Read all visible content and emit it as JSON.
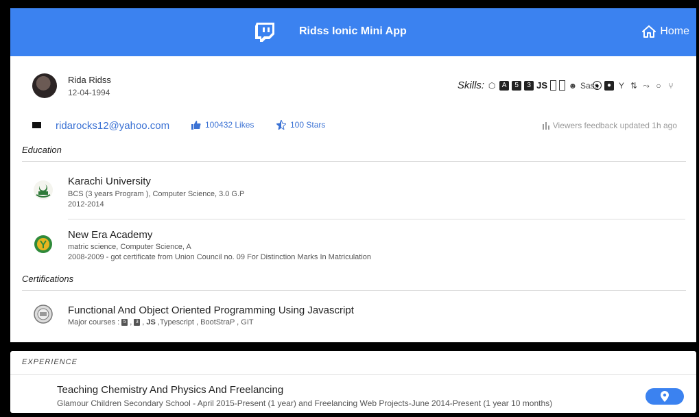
{
  "header": {
    "title": "Ridss Ionic Mini App",
    "home_label": "Home"
  },
  "profile": {
    "name": "Rida Ridss",
    "dob": "12-04-1994",
    "skills_label": "Skills:"
  },
  "skills_icons": [
    {
      "name": "nodejs-icon",
      "glyph": "⬡",
      "style": "thin"
    },
    {
      "name": "angular-icon",
      "glyph": "A",
      "style": "fill"
    },
    {
      "name": "html5-icon",
      "glyph": "5",
      "style": "fill"
    },
    {
      "name": "css3-icon",
      "glyph": "3",
      "style": "fill"
    },
    {
      "name": "javascript-icon",
      "glyph": "JS",
      "style": "js"
    },
    {
      "name": "mobile-icon",
      "glyph": "",
      "style": "rect"
    },
    {
      "name": "tablet-icon",
      "glyph": "",
      "style": "rect"
    },
    {
      "name": "reddit-icon",
      "glyph": "☻",
      "style": "thin"
    },
    {
      "name": "sass-icon",
      "glyph": "Sass",
      "style": "thin"
    },
    {
      "name": "ionic-icon",
      "glyph": "●",
      "style": "round"
    },
    {
      "name": "github-icon",
      "glyph": "●",
      "style": "fill"
    },
    {
      "name": "git-branch-icon",
      "glyph": "Y",
      "style": "thin"
    },
    {
      "name": "git-compare-icon",
      "glyph": "⇅",
      "style": "thin"
    },
    {
      "name": "git-merge-icon",
      "glyph": "⤳",
      "style": "thin"
    },
    {
      "name": "git-commit-icon",
      "glyph": "○",
      "style": "thin"
    },
    {
      "name": "git-network-icon",
      "glyph": "⑂",
      "style": "thin"
    }
  ],
  "contact": {
    "email": "ridarocks12@yahoo.com",
    "likes": "100432 Likes",
    "stars": "100 Stars",
    "feedback": "Viewers feedback updated 1h ago"
  },
  "education": {
    "title": "Education",
    "items": [
      {
        "name": "Karachi University",
        "detail": "BCS (3 years Program ), Computer Science, 3.0 G.P",
        "years": "2012-2014"
      },
      {
        "name": "New Era Academy",
        "detail": "matric science, Computer Science, A",
        "years": "2008-2009 - got certificate from Union Council no. 09 For Distinction Marks In Matriculation"
      }
    ]
  },
  "certifications": {
    "title": "Certifications",
    "items": [
      {
        "name": "Functional And Object Oriented Programming Using Javascript",
        "courses_label": "Major courses :",
        "courses_tail": ",Typescript , BootStraP , GIT"
      }
    ]
  },
  "experience": {
    "title": "EXPERIENCE",
    "items": [
      {
        "name": "Teaching Chemistry And Physics And Freelancing",
        "detail": "Glamour Children Secondary School - April 2015-Present (1 year) and Freelancing Web Projects-June 2014-Present (1 year 10 months)"
      }
    ]
  },
  "colors": {
    "primary": "#3b82f0",
    "link": "#3b72d4",
    "muted": "#999999"
  }
}
